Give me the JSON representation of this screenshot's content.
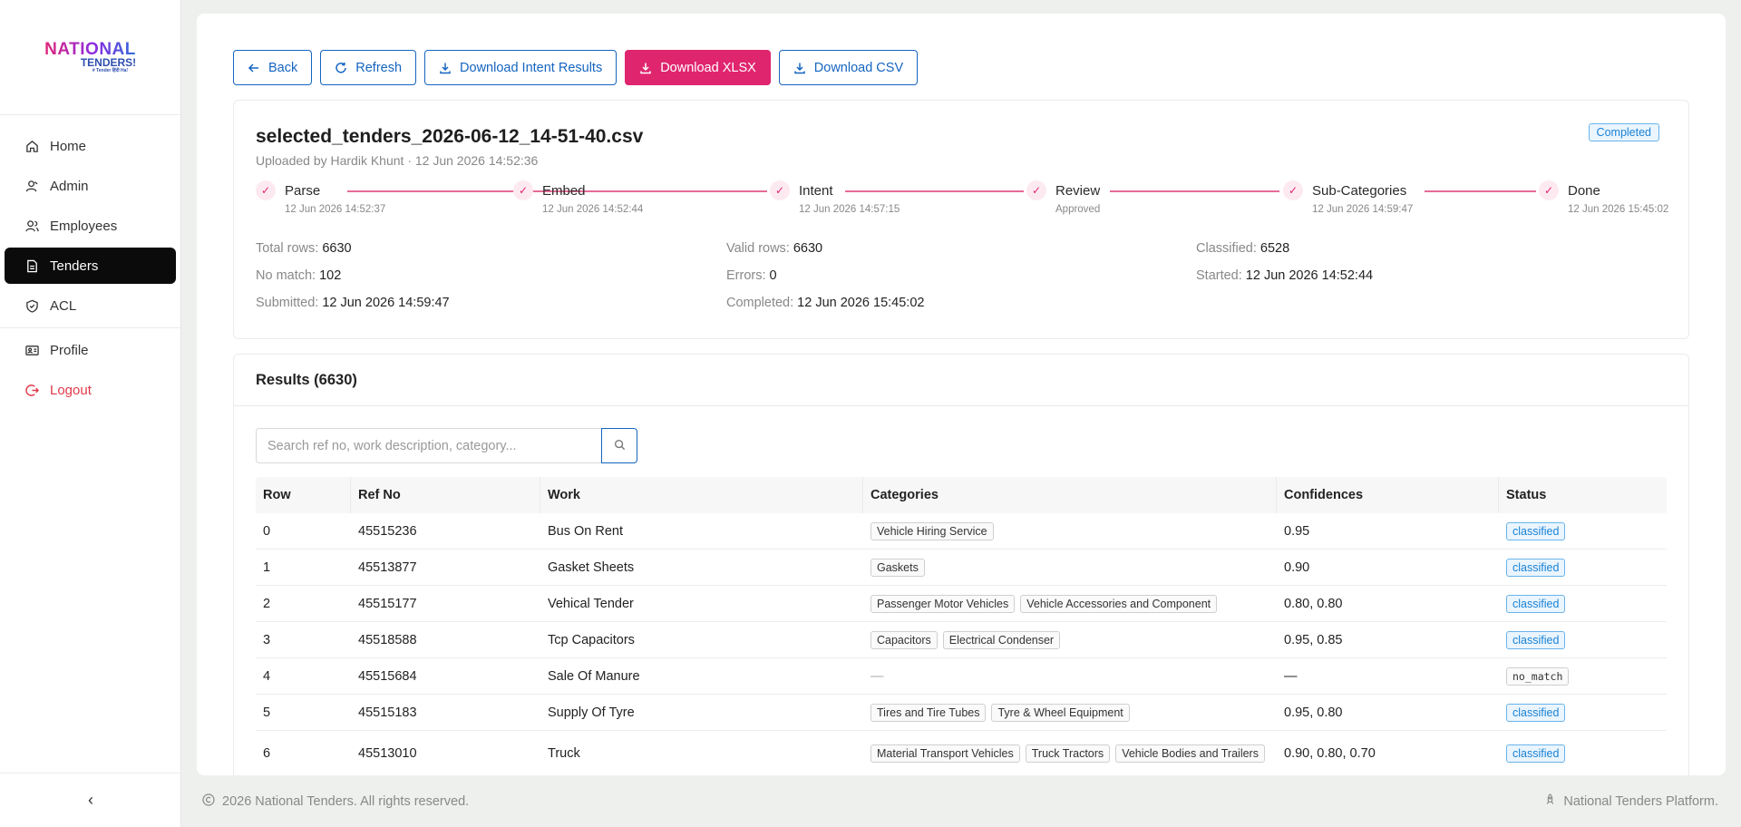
{
  "brand": {
    "logo_main": "NATIONAL",
    "logo_sub": "TENDERS!",
    "logo_tag": "# Tender हिंदी Ha!"
  },
  "sidebar": {
    "items": [
      {
        "label": "Home",
        "icon": "home-icon"
      },
      {
        "label": "Admin",
        "icon": "user-icon"
      },
      {
        "label": "Employees",
        "icon": "users-icon"
      },
      {
        "label": "Tenders",
        "icon": "document-icon",
        "active": true
      },
      {
        "label": "ACL",
        "icon": "shield-icon"
      },
      {
        "label": "Profile",
        "icon": "id-card-icon"
      },
      {
        "label": "Logout",
        "icon": "logout-icon"
      }
    ],
    "collapse_glyph": "‹"
  },
  "toolbar": {
    "back": "Back",
    "refresh": "Refresh",
    "download_intent": "Download Intent Results",
    "download_xlsx": "Download XLSX",
    "download_csv": "Download CSV"
  },
  "upload": {
    "file_name": "selected_tenders_2026-06-12_14-51-40.csv",
    "subtitle": "Uploaded by Hardik Khunt · 12 Jun 2026 14:52:36",
    "status": "Completed",
    "steps": [
      {
        "label": "Parse",
        "sub": "12 Jun 2026 14:52:37"
      },
      {
        "label": "Embed",
        "sub": "12 Jun 2026 14:52:44"
      },
      {
        "label": "Intent",
        "sub": "12 Jun 2026 14:57:15"
      },
      {
        "label": "Review",
        "sub": "Approved"
      },
      {
        "label": "Sub-Categories",
        "sub": "12 Jun 2026 14:59:47"
      },
      {
        "label": "Done",
        "sub": "12 Jun 2026 15:45:02"
      }
    ],
    "stats": {
      "total_rows": {
        "k": "Total rows:",
        "v": "6630"
      },
      "valid_rows": {
        "k": "Valid rows:",
        "v": "6630"
      },
      "classified": {
        "k": "Classified:",
        "v": "6528"
      },
      "no_match": {
        "k": "No match:",
        "v": "102"
      },
      "errors": {
        "k": "Errors:",
        "v": "0"
      },
      "started": {
        "k": "Started:",
        "v": "12 Jun 2026 14:52:44"
      },
      "submitted": {
        "k": "Submitted:",
        "v": "12 Jun 2026 14:59:47"
      },
      "completed": {
        "k": "Completed:",
        "v": "12 Jun 2026 15:45:02"
      }
    }
  },
  "results": {
    "title": "Results (6630)",
    "search_placeholder": "Search ref no, work description, category...",
    "columns": [
      "Row",
      "Ref No",
      "Work",
      "Categories",
      "Confidences",
      "Status"
    ],
    "rows": [
      {
        "row": "0",
        "ref": "45515236",
        "work": "Bus On Rent",
        "categories": [
          "Vehicle Hiring Service"
        ],
        "conf": "0.95",
        "status": "classified"
      },
      {
        "row": "1",
        "ref": "45513877",
        "work": "Gasket Sheets",
        "categories": [
          "Gaskets"
        ],
        "conf": "0.90",
        "status": "classified"
      },
      {
        "row": "2",
        "ref": "45515177",
        "work": "Vehical Tender",
        "categories": [
          "Passenger Motor Vehicles",
          "Vehicle Accessories and Component"
        ],
        "conf": "0.80, 0.80",
        "status": "classified"
      },
      {
        "row": "3",
        "ref": "45518588",
        "work": "Tcp Capacitors",
        "categories": [
          "Capacitors",
          "Electrical Condenser"
        ],
        "conf": "0.95, 0.85",
        "status": "classified"
      },
      {
        "row": "4",
        "ref": "45515684",
        "work": "Sale Of Manure",
        "categories": [],
        "cat_empty": "—",
        "conf": "—",
        "status": "no_match"
      },
      {
        "row": "5",
        "ref": "45515183",
        "work": "Supply Of Tyre",
        "categories": [
          "Tires and Tire Tubes",
          "Tyre & Wheel Equipment"
        ],
        "conf": "0.95, 0.80",
        "status": "classified"
      },
      {
        "row": "6",
        "ref": "45513010",
        "work": "Truck",
        "categories": [
          "Material Transport Vehicles",
          "Truck Tractors",
          "Vehicle Bodies and Trailers"
        ],
        "conf": "0.90, 0.80, 0.70",
        "status": "classified"
      }
    ]
  },
  "footer": {
    "copyright": "2026 National Tenders. All rights reserved.",
    "platform": "National Tenders Platform."
  },
  "colors": {
    "accent_pink": "#e0256f",
    "accent_blue": "#1565c0",
    "active_nav": "#0b0b0b"
  }
}
